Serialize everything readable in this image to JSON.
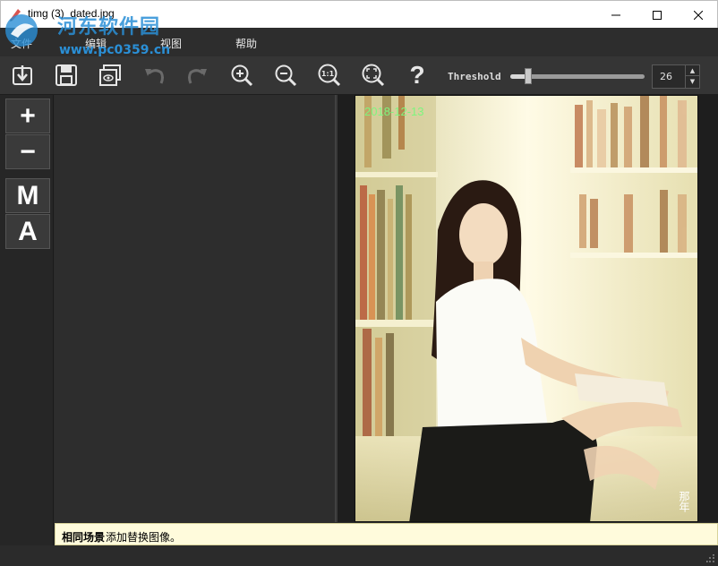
{
  "window": {
    "title": "timg (3)_dated.jpg",
    "icon": "app-pen-icon"
  },
  "watermark": {
    "brand": "河东软件园",
    "url": "www.pc0359.cn"
  },
  "menu": {
    "file": "文件",
    "edit": "编辑",
    "view": "视图",
    "help": "帮助"
  },
  "toolbar": {
    "buttons": [
      "import-icon",
      "save-icon",
      "preview-icon",
      "undo-icon",
      "redo-icon",
      "zoom-in-icon",
      "zoom-out-icon",
      "actual-size-icon",
      "fit-icon",
      "help-icon"
    ],
    "actual_size_label": "1:1",
    "help_glyph": "?",
    "threshold_label": "Threshold",
    "threshold_value": "26",
    "threshold_fraction": 0.13
  },
  "side_tools": {
    "add": "+",
    "remove": "−",
    "manual": "M",
    "auto": "A"
  },
  "photo": {
    "date_stamp": "2018-12-13",
    "signature": "那年"
  },
  "status": {
    "bold": "相同场景",
    "rest": "添加替换图像。"
  },
  "colors": {
    "panel": "#2d2d2d",
    "toolbar": "#353535",
    "status_bg": "#fffbdc",
    "stamp_green": "#7ef57e"
  }
}
